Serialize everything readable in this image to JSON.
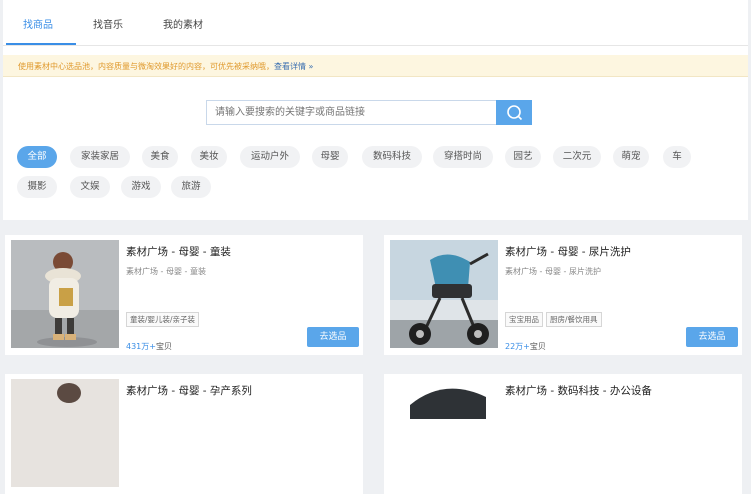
{
  "tabs": [
    {
      "label": "找商品",
      "active": true
    },
    {
      "label": "找音乐",
      "active": false
    },
    {
      "label": "我的素材",
      "active": false
    }
  ],
  "notice": {
    "text": "使用素材中心选品池，内容质量与微淘效果好的内容，可优先被采纳哦，",
    "link": "查看详情 »"
  },
  "search": {
    "placeholder": "请输入要搜索的关键字或商品链接",
    "icon": "search-icon"
  },
  "categories": [
    "全部",
    "家装家居",
    "美食",
    "美妆",
    "运动户外",
    "母婴",
    "数码科技",
    "穿搭时尚",
    "园艺",
    "二次元",
    "萌宠",
    "车",
    "摄影",
    "文娱",
    "游戏",
    "旅游"
  ],
  "active_category": "全部",
  "cards": [
    {
      "title": "素材广场 - 母婴 - 童装",
      "path": "素材广场 - 母婴 - 童装",
      "tags": [
        "童装/婴儿装/亲子装"
      ],
      "count_num": "431万+",
      "count_unit": "宝贝",
      "button": "去选品",
      "image": "child-in-winter-coat"
    },
    {
      "title": "素材广场 - 母婴 - 尿片洗护",
      "path": "素材广场 - 母婴 - 尿片洗护",
      "tags": [
        "宝宝用品",
        "厨房/餐饮用具"
      ],
      "count_num": "22万+",
      "count_unit": "宝贝",
      "button": "去选品",
      "image": "baby-stroller"
    },
    {
      "title": "素材广场 - 母婴 - 孕产系列",
      "image": "maternity"
    },
    {
      "title": "素材广场 - 数码科技 - 办公设备",
      "image": "office-device"
    }
  ],
  "colors": {
    "accent": "#5aa6ea",
    "link": "#3a8ee6",
    "notice_bg": "#fdf6e0",
    "notice_text": "#e09a2e"
  }
}
